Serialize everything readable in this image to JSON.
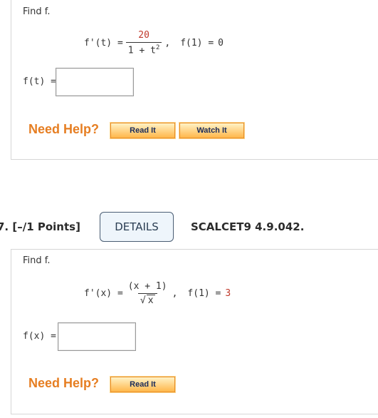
{
  "q1": {
    "prompt": "Find f.",
    "fprime_lhs": "f'(t) =",
    "numerator": "20",
    "den_base": "1 + t",
    "den_exp": "2",
    "comma": ",",
    "condition_lhs": "f(1) =",
    "condition_val": "0",
    "answer_label": "f(t) =",
    "answer_value": "",
    "need_help": "Need Help?",
    "read_it": "Read It",
    "watch_it": "Watch It"
  },
  "q2_header": {
    "number": "7. [–/1 Points]",
    "details": "DETAILS",
    "code": "SCALCET9 4.9.042."
  },
  "q2": {
    "prompt": "Find f.",
    "fprime_lhs": "f'(x) =",
    "numerator": "(x + 1)",
    "den_sqrt_sym": "√",
    "den_sqrt_arg": "x",
    "comma": ",",
    "condition_lhs": "f(1) =",
    "condition_val": "3",
    "answer_label": "f(x) =",
    "answer_value": "",
    "need_help": "Need Help?",
    "read_it": "Read It"
  },
  "colors": {
    "help_orange": "#e67e22",
    "condition_red": "#c0392b",
    "button_navy": "#1a2c5a"
  }
}
